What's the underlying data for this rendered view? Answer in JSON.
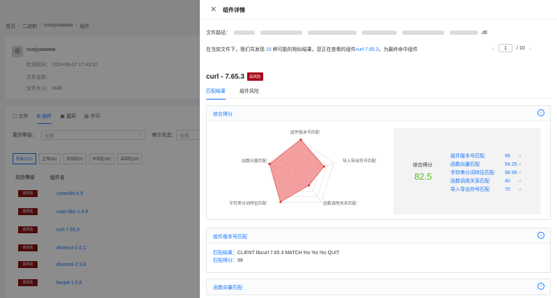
{
  "background": {
    "breadcrumb": [
      "首页",
      "二进制",
      "nuojiyaaaaaa",
      "组件"
    ],
    "user": "nuojiyaaaaaa",
    "detect_time": "检测时间： 2024-06-07 17:43:32",
    "file_name_label": "文件名称：",
    "file_size_label": "文件大小： 6MB",
    "tabs": [
      "文件",
      "组件",
      "漏洞",
      "许可"
    ],
    "filter_label": "置信等级：",
    "filter_value": "全部",
    "audit_label": "审计状态：",
    "audit_value": "全部",
    "risk_filters": [
      "所有(122)",
      "正常(81)",
      "低风险(5)",
      "中风险(36)",
      "高风险(20)"
    ],
    "col_risk": "风险等级",
    "col_name": "组件名",
    "rows": [
      {
        "badge": "高风险",
        "name": "coreutils-6.9"
      },
      {
        "badge": "高风险",
        "name": "cups-libs-1.4.6"
      },
      {
        "badge": "高风险",
        "name": "curl-7.65.3"
      },
      {
        "badge": "高风险",
        "name": "dovecot-2.0.1"
      },
      {
        "badge": "高风险",
        "name": "dovecot-2.3.8"
      },
      {
        "badge": "高风险",
        "name": "fwupd-1.5.8"
      }
    ]
  },
  "drawer": {
    "title": "组件详情",
    "file_path_label": "文件路径：",
    "file_path_suffix": ".dll",
    "result_prefix": "在当前文件下，我们共发现",
    "result_count": "10",
    "result_mid": "种可能的相似结果，您正在查看的组件",
    "result_component": "curl-7.65.3",
    "result_suffix": "，为最终命中组件",
    "pager_current": "1",
    "pager_total": "/ 10",
    "component_name": "curl - 7.65.3",
    "risk_badge": "高风险",
    "tabs": [
      "匹配结果",
      "组件风险"
    ],
    "sections": {
      "overall": "综合得分",
      "version": "组件版本号匹配",
      "func_vector": "函数向量匹配"
    },
    "radar_axes": [
      "组件版本号匹配",
      "导入导出符号匹配",
      "函数调用关系匹配",
      "字符串分词特征匹配",
      "函数向量匹配"
    ],
    "score_label": "综合得分",
    "score_value": "82.5",
    "scores": [
      {
        "name": "组件版本号匹配",
        "value": "99"
      },
      {
        "name": "函数向量匹配",
        "value": "94.25"
      },
      {
        "name": "字符串分词特征匹配",
        "value": "98.99"
      },
      {
        "name": "函数调用关系匹配",
        "value": "40"
      },
      {
        "name": "导入导出符号匹配",
        "value": "70"
      }
    ],
    "match_result_label": "匹配结果：",
    "match_result_value": "CLIENT libcurl 7.65.3 MATCH %s %s %s QUIT",
    "match_score_label": "匹配得分：",
    "match_score_value": "99"
  },
  "colors": {
    "accent": "#1677ff",
    "danger": "#a8071a",
    "score_green": "#52c41a",
    "radar_fill": "#f08080"
  }
}
